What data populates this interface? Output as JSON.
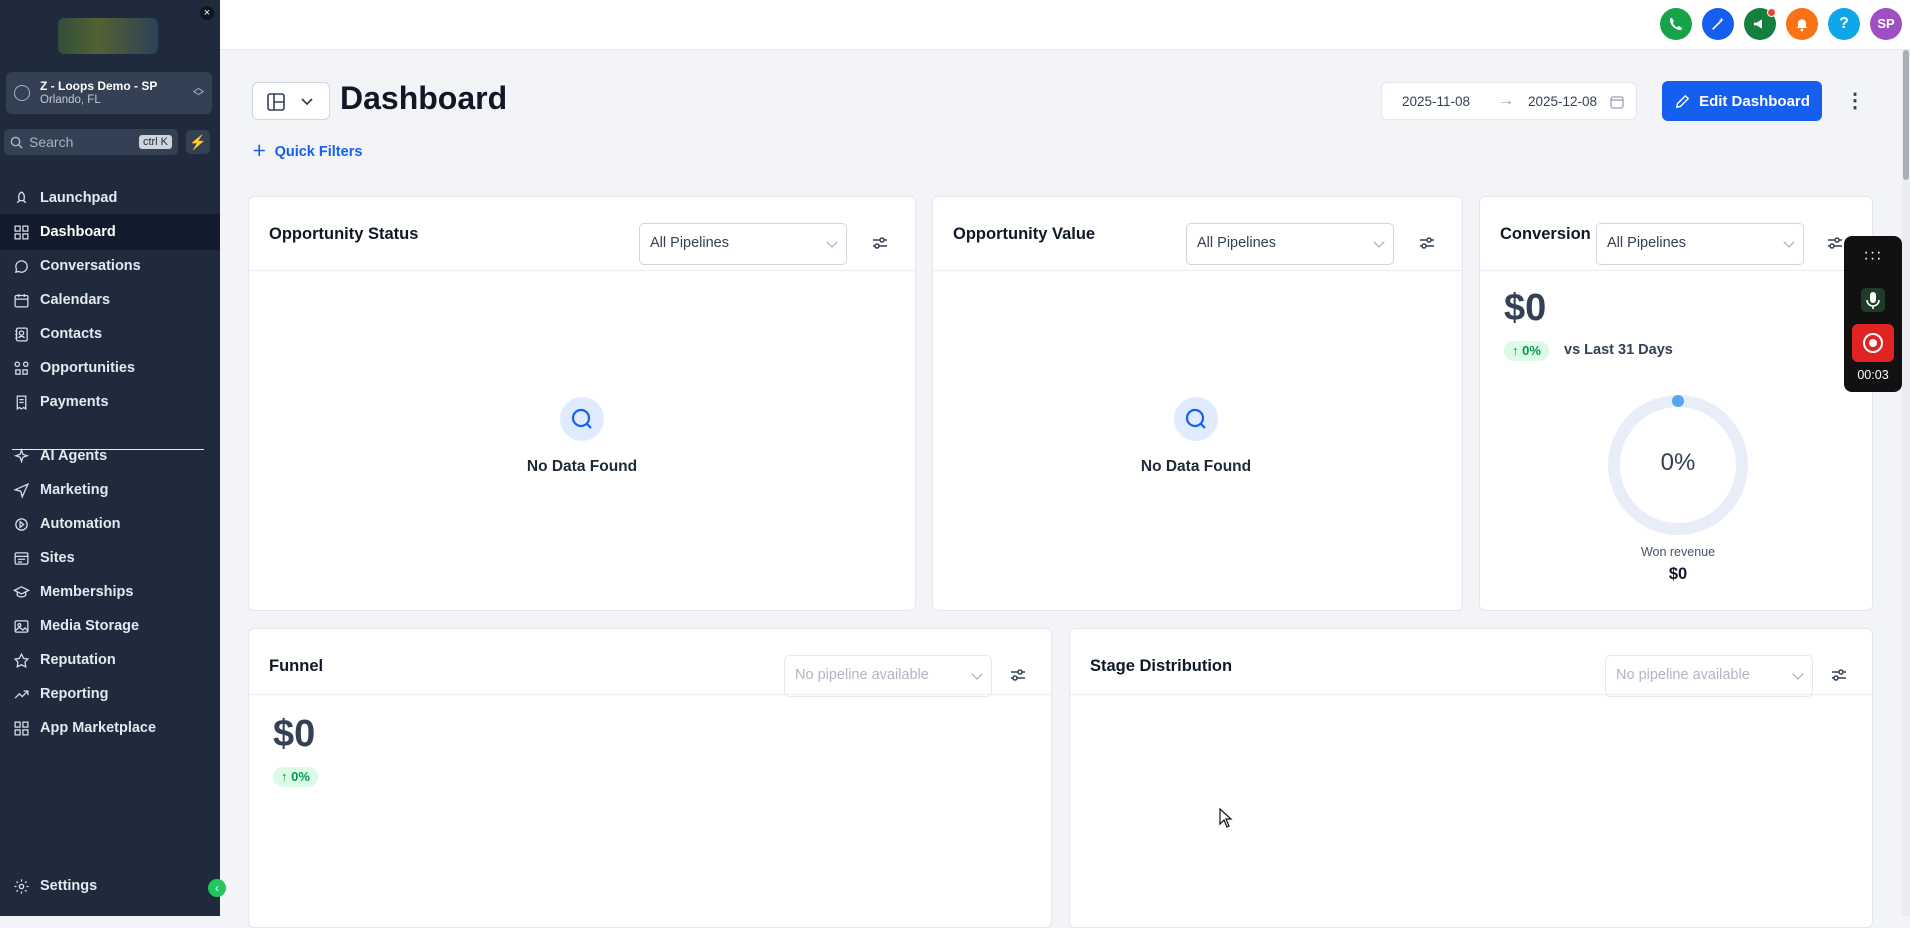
{
  "sidebar": {
    "account_name": "Z - Loops Demo - SP",
    "account_location": "Orlando, FL",
    "search_placeholder": "Search",
    "search_shortcut": "ctrl K",
    "items": [
      {
        "label": "Launchpad",
        "icon": "rocket-icon"
      },
      {
        "label": "Dashboard",
        "icon": "grid-icon",
        "active": true
      },
      {
        "label": "Conversations",
        "icon": "chat-bubble-icon"
      },
      {
        "label": "Calendars",
        "icon": "calendar-icon"
      },
      {
        "label": "Contacts",
        "icon": "contact-book-icon"
      },
      {
        "label": "Opportunities",
        "icon": "opportunities-icon"
      },
      {
        "label": "Payments",
        "icon": "receipt-icon"
      },
      {
        "label": "AI Agents",
        "icon": "sparkle-icon"
      },
      {
        "label": "Marketing",
        "icon": "send-icon"
      },
      {
        "label": "Automation",
        "icon": "automation-icon"
      },
      {
        "label": "Sites",
        "icon": "sites-icon"
      },
      {
        "label": "Memberships",
        "icon": "graduation-icon"
      },
      {
        "label": "Media Storage",
        "icon": "image-icon"
      },
      {
        "label": "Reputation",
        "icon": "star-icon"
      },
      {
        "label": "Reporting",
        "icon": "trend-icon"
      },
      {
        "label": "App Marketplace",
        "icon": "apps-icon"
      }
    ],
    "settings_label": "Settings"
  },
  "topbar": {
    "avatar_initials": "SP",
    "buttons": [
      {
        "name": "phone",
        "color": "#17a34a"
      },
      {
        "name": "magic",
        "color": "#155eef"
      },
      {
        "name": "announcement",
        "color": "#15803d"
      },
      {
        "name": "notifications",
        "color": "#f97316"
      },
      {
        "name": "help",
        "color": "#0ea5e9"
      },
      {
        "name": "avatar",
        "color": "#9e4fc2"
      }
    ],
    "help_glyph": "?"
  },
  "header": {
    "title": "Dashboard",
    "quick_filters": "Quick Filters",
    "date_from": "2025-11-08",
    "date_to": "2025-12-08",
    "edit_label": "Edit Dashboard"
  },
  "cards": {
    "opportunity_status": {
      "title": "Opportunity Status",
      "select": "All Pipelines",
      "empty": "No Data Found"
    },
    "opportunity_value": {
      "title": "Opportunity Value",
      "select": "All Pipelines",
      "empty": "No Data Found"
    },
    "conversion": {
      "title": "Conversion",
      "select": "All Pipelines",
      "value": "$0",
      "change": "0%",
      "compare": "vs Last 31 Days",
      "donut_pct": "0%",
      "won_label": "Won revenue",
      "won_value": "$0"
    },
    "funnel": {
      "title": "Funnel",
      "select": "No pipeline available",
      "value": "$0",
      "change": "0%"
    },
    "stage_distribution": {
      "title": "Stage Distribution",
      "select": "No pipeline available"
    }
  },
  "call_widget": {
    "timer": "00:03"
  }
}
